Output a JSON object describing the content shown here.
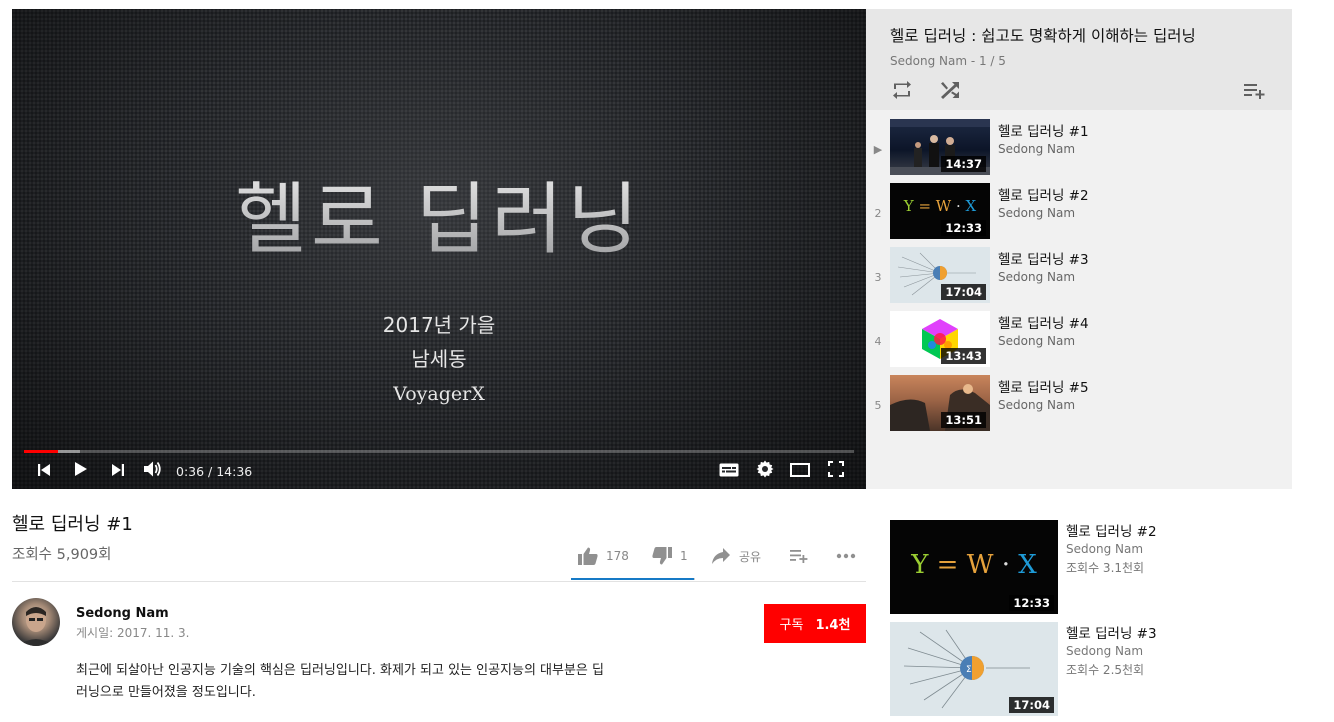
{
  "player": {
    "slide": {
      "title": "헬로 딥러닝",
      "year": "2017년 가을",
      "author": "남세동",
      "company": "VoyagerX"
    },
    "time_display": "0:36 / 14:36",
    "progress_played": 0.041,
    "progress_buffered": 0.068,
    "controls": [
      "previous-icon",
      "play-icon",
      "next-icon",
      "volume-icon",
      "subtitles-icon",
      "settings-icon",
      "theater-mode-icon",
      "fullscreen-icon"
    ]
  },
  "playlist": {
    "title": "헬로 딥러닝 : 쉽고도 명확하게 이해하는 딥러닝",
    "meta": "Sedong Nam - 1 / 5",
    "items": [
      {
        "index": "▶",
        "title": "헬로 딥러닝 #1",
        "channel": "Sedong Nam",
        "duration": "14:37"
      },
      {
        "index": "2",
        "title": "헬로 딥러닝 #2",
        "channel": "Sedong Nam",
        "duration": "12:33"
      },
      {
        "index": "3",
        "title": "헬로 딥러닝 #3",
        "channel": "Sedong Nam",
        "duration": "17:04"
      },
      {
        "index": "4",
        "title": "헬로 딥러닝 #4",
        "channel": "Sedong Nam",
        "duration": "13:43"
      },
      {
        "index": "5",
        "title": "헬로 딥러닝 #5",
        "channel": "Sedong Nam",
        "duration": "13:51"
      }
    ]
  },
  "video": {
    "title": "헬로 딥러닝 #1",
    "views": "조회수 5,909회",
    "likes": "178",
    "dislikes": "1",
    "share_label": "공유",
    "like_ratio": 0.994
  },
  "channel": {
    "name": "Sedong Nam",
    "published": "게시일: 2017. 11. 3.",
    "subscribe_label": "구독",
    "subscriber_count": "1.4천"
  },
  "description": {
    "line1": "최근에 되살아난 인공지능 기술의 핵심은 딥러닝입니다. 화제가 되고 있는 인공지능의 대부분은 딥",
    "line2": "러닝으로 만들어졌을 정도입니다."
  },
  "related": [
    {
      "title": "헬로 딥러닝 #2",
      "channel": "Sedong Nam",
      "views": "조회수 3.1천회",
      "duration": "12:33"
    },
    {
      "title": "헬로 딥러닝 #3",
      "channel": "Sedong Nam",
      "views": "조회수 2.5천회",
      "duration": "17:04"
    }
  ],
  "colors": {
    "accent": "#ff0000",
    "progress_red": "#ff0000",
    "like_blue": "#167ac6",
    "playlist_bg": "#f1f1f1",
    "formula_y": "#9acd32",
    "formula_w": "#e6a23c",
    "formula_x": "#1e9bd7"
  }
}
